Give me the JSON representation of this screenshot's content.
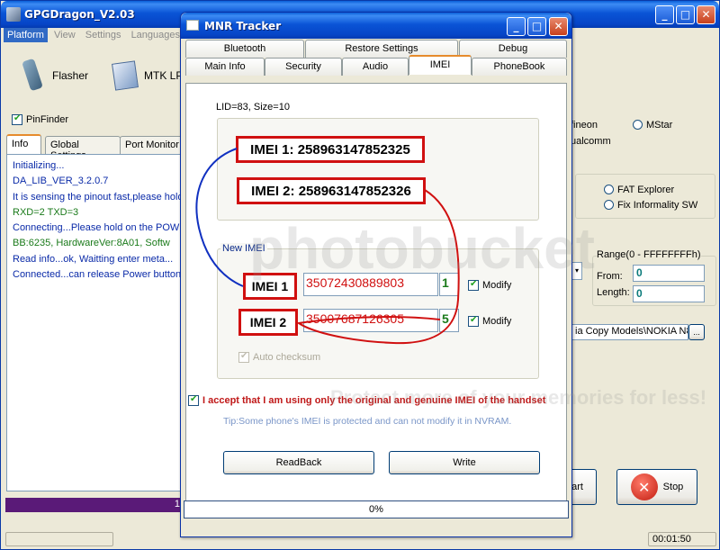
{
  "app": {
    "title": "GPGDragon_V2.03",
    "menu": [
      "Platform",
      "View",
      "Settings",
      "Languages"
    ],
    "toolbar": {
      "flasher": "Flasher",
      "mtk": "MTK LPE"
    },
    "pinfinder_label": "PinFinder",
    "tabs": [
      "Info",
      "Global Settings",
      "Port Monitor"
    ],
    "log": [
      {
        "text": "Initializing...",
        "color": "blue"
      },
      {
        "text": "DA_LIB_VER_3.2.0.7",
        "color": "blue"
      },
      {
        "text": "It is sensing the pinout fast,please hold",
        "color": "blue"
      },
      {
        "text": "RXD=2  TXD=3",
        "color": "green"
      },
      {
        "text": "Connecting...Please hold on the POWE",
        "color": "blue"
      },
      {
        "text": "BB:6235,   HardwareVer:8A01,   Softw",
        "color": "green"
      },
      {
        "text": "Read info...ok, Waitting enter meta...",
        "color": "blue"
      },
      {
        "text": "Connected...can release Power button",
        "color": "blue"
      }
    ],
    "right": {
      "infineon": "fineon",
      "mstar": "MStar",
      "qualcomm": "ualcomm",
      "fat_explorer": "FAT Explorer",
      "fix_informality": "Fix Informality SW",
      "range_label": "Range(0 - FFFFFFFFh)",
      "from_label": "From:",
      "from_value": "0",
      "length_label": "Length:",
      "length_value": "0",
      "path_value": "ia Copy Models\\NOKIA N8 N",
      "browse": "...",
      "start_partial": "art",
      "stop": "Stop"
    },
    "progress_text": "1",
    "status_time": "00:01:50"
  },
  "dialog": {
    "title": "MNR Tracker",
    "tabs_row1": [
      "Bluetooth",
      "Restore Settings",
      "Debug"
    ],
    "tabs_row2": [
      "Main Info",
      "Security",
      "Audio",
      "IMEI",
      "PhoneBook"
    ],
    "lid_text": "LID=83, Size=10",
    "imei1_label": "IMEI 1:",
    "imei1_value": "258963147852325",
    "imei2_label": "IMEI 2:",
    "imei2_value": "258963147852326",
    "new_imei_legend": "New IMEI",
    "new_imei1_label": "IMEI 1",
    "new_imei2_label": "IMEI 2",
    "new_imei1_value": "35072430889803",
    "new_imei1_check": "1",
    "new_imei2_value": "35007687126305",
    "new_imei2_check": "5",
    "modify_label": "Modify",
    "auto_checksum": "Auto checksum",
    "accept_text": "I accept that I am using only the original and genuine IMEI of the handset",
    "tip_text": "Tip:Some phone's IMEI is protected and can not modify it in NVRAM.",
    "readback": "ReadBack",
    "write": "Write",
    "progress": "0%"
  },
  "watermark": {
    "main": "photobucket",
    "sub": "Protect more of your memories for less!"
  },
  "colors": {
    "xp_blue": "#0a54d6",
    "red": "#d01010",
    "green": "#1a7a1a"
  }
}
